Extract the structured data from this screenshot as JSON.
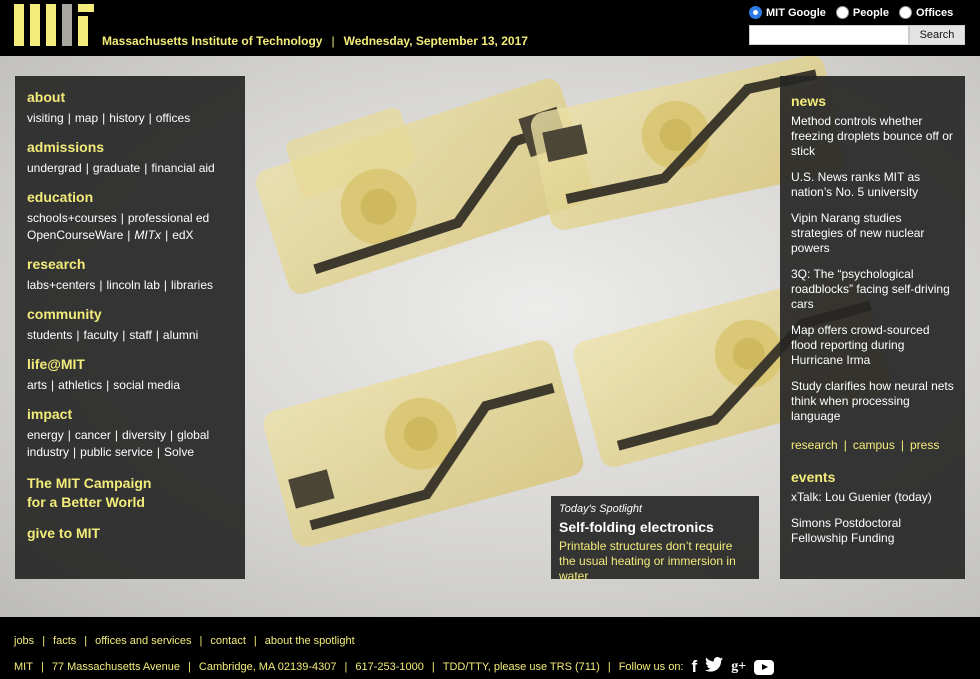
{
  "header": {
    "logo_name": "MIT logo",
    "institute": "Massachusetts Institute of Technology",
    "date": "Wednesday, September 13, 2017",
    "search": {
      "options": [
        "MIT Google",
        "People",
        "Offices"
      ],
      "selected": "MIT Google",
      "value": "",
      "button_label": "Search"
    }
  },
  "nav": {
    "about": {
      "title": "about",
      "links": [
        "visiting",
        "map",
        "history",
        "offices"
      ]
    },
    "admissions": {
      "title": "admissions",
      "links": [
        "undergrad",
        "graduate",
        "financial aid"
      ]
    },
    "education": {
      "title": "education",
      "links": [
        "schools+courses",
        "professional ed",
        "OpenCourseWare",
        "MITx",
        "edX"
      ]
    },
    "research": {
      "title": "research",
      "links": [
        "labs+centers",
        "lincoln lab",
        "libraries"
      ]
    },
    "community": {
      "title": "community",
      "links": [
        "students",
        "faculty",
        "staff",
        "alumni"
      ]
    },
    "life": {
      "title": "life@MIT",
      "links": [
        "arts",
        "athletics",
        "social media"
      ]
    },
    "impact": {
      "title": "impact",
      "links": [
        "energy",
        "cancer",
        "diversity",
        "global",
        "industry",
        "public service",
        "Solve"
      ]
    },
    "campaign_line1": "The MIT Campaign",
    "campaign_line2": "for a Better World",
    "give": "give to MIT"
  },
  "news": {
    "title": "news",
    "items": [
      "Method controls whether freezing droplets bounce off or stick",
      "U.S. News ranks MIT as nation’s No. 5 university",
      "Vipin Narang studies strategies of new nuclear powers",
      "3Q: The “psychological roadblocks” facing self-driving cars",
      "Map offers crowd-sourced flood reporting during Hurricane Irma",
      "Study clarifies how neural nets think when processing language"
    ],
    "links": [
      "research",
      "campus",
      "press"
    ]
  },
  "events": {
    "title": "events",
    "items": [
      "xTalk: Lou Guenier (today)",
      "Simons Postdoctoral Fellowship Funding"
    ]
  },
  "spotlight": {
    "kicker": "Today's Spotlight",
    "title": "Self-folding electronics",
    "description": "Printable structures don’t require the usual heating or immersion in water"
  },
  "footer": {
    "links": [
      "jobs",
      "facts",
      "offices and services",
      "contact",
      "about the spotlight"
    ],
    "info": [
      "MIT",
      "77 Massachusetts Avenue",
      "Cambridge, MA 02139-4307",
      "617-253-1000",
      "TDD/TTY, please use TRS (711)"
    ],
    "follow_label": "Follow us on:",
    "social_icons": [
      "facebook-icon",
      "twitter-icon",
      "google-plus-icon",
      "youtube-icon"
    ],
    "social_glyphs": {
      "facebook": "f",
      "google_plus": "g+"
    }
  },
  "colors": {
    "accent": "#f3ec7a",
    "panel": "#262626",
    "background": "#000000"
  }
}
